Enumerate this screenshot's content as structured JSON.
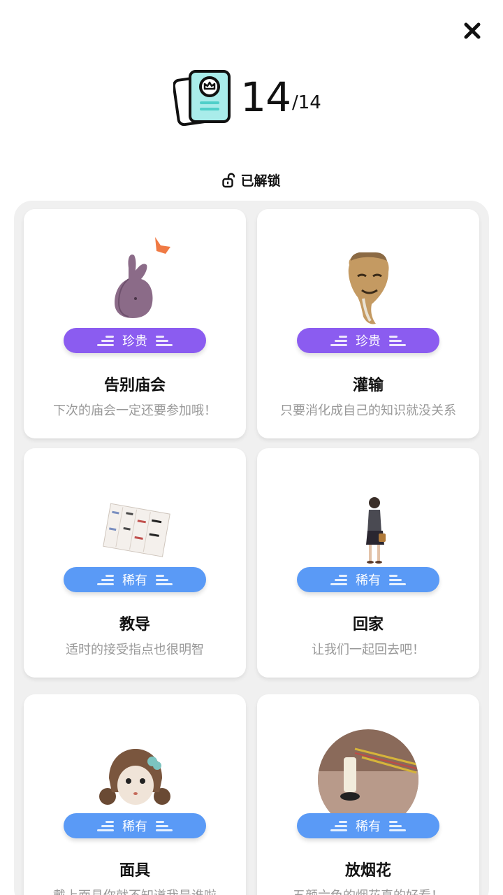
{
  "header": {
    "count": "14",
    "total": "/14"
  },
  "section": {
    "label": "已解锁"
  },
  "cards": [
    {
      "rarity": "珍贵",
      "title": "告别庙会",
      "desc": "下次的庙会一定还要参加哦！"
    },
    {
      "rarity": "珍贵",
      "title": "灌输",
      "desc": "只要消化成自己的知识就没关系"
    },
    {
      "rarity": "稀有",
      "title": "教导",
      "desc": "适时的接受指点也很明智"
    },
    {
      "rarity": "稀有",
      "title": "回家",
      "desc": "让我们一起回去吧！"
    },
    {
      "rarity": "稀有",
      "title": "面具",
      "desc": "戴上面具你就不知道我是谁啦"
    },
    {
      "rarity": "稀有",
      "title": "放烟花",
      "desc": "五颜六色的烟花真的好看！"
    }
  ],
  "colors": {
    "precious": "#8b5cf0",
    "rare": "#5a9af6",
    "panel": "#f0f0f0"
  },
  "icons": [
    "close-icon",
    "collection-book-icon",
    "unlock-icon"
  ]
}
